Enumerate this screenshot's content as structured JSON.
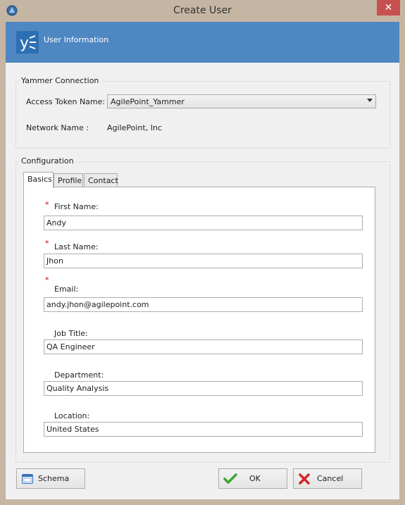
{
  "window": {
    "title": "Create User"
  },
  "banner": {
    "title": "User Information"
  },
  "yammer": {
    "group_label": "Yammer Connection",
    "access_token_label": "Access Token Name:",
    "access_token_value": "AgilePoint_Yammer",
    "network_label": "Network Name :",
    "network_value": "AgilePoint, Inc"
  },
  "configuration": {
    "group_label": "Configuration",
    "tabs": [
      {
        "label": "Basics"
      },
      {
        "label": "Profile"
      },
      {
        "label": "Contact"
      }
    ],
    "required_marker": "*",
    "fields": {
      "first_name": {
        "label": "First Name:",
        "value": "Andy"
      },
      "last_name": {
        "label": "Last Name:",
        "value": "Jhon"
      },
      "email": {
        "label": "Email:",
        "value": "andy.jhon@agilepoint.com"
      },
      "job_title": {
        "label": "Job Title:",
        "value": "QA Engineer"
      },
      "department": {
        "label": "Department:",
        "value": "Quality Analysis"
      },
      "location": {
        "label": "Location:",
        "value": "United States"
      }
    }
  },
  "footer": {
    "schema_label": "Schema",
    "ok_label": "OK",
    "cancel_label": "Cancel"
  },
  "colors": {
    "banner": "#4f87c2",
    "close_button": "#c75050",
    "required": "#cc0000"
  },
  "icons": {
    "app": "agilepoint-app-icon",
    "banner": "yammer-logo",
    "schema": "schema-window-icon",
    "ok": "green-check-icon",
    "cancel": "red-x-icon"
  }
}
